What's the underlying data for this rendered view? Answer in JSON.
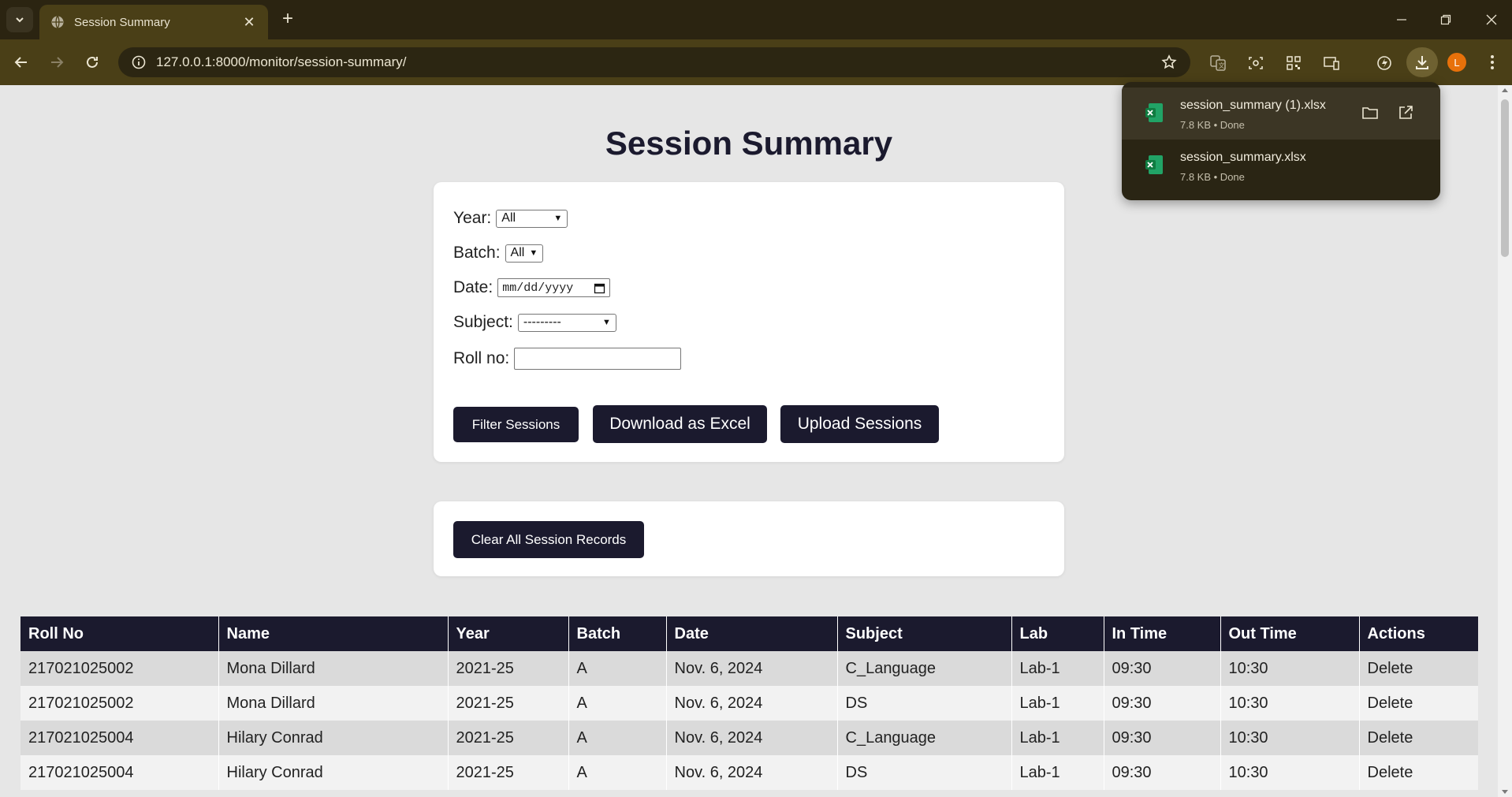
{
  "browser": {
    "tab_title": "Session Summary",
    "url": "127.0.0.1:8000/monitor/session-summary/",
    "profile_initial": "L"
  },
  "page": {
    "title": "Session Summary"
  },
  "filters": {
    "year_label": "Year:",
    "year_value": "All",
    "batch_label": "Batch:",
    "batch_value": "All",
    "date_label": "Date:",
    "date_placeholder": "mm/dd/yyyy",
    "subject_label": "Subject:",
    "subject_value": "---------",
    "roll_label": "Roll no:",
    "roll_value": ""
  },
  "buttons": {
    "filter": "Filter Sessions",
    "download": "Download as Excel",
    "upload": "Upload Sessions",
    "clear": "Clear All Session Records"
  },
  "table": {
    "headers": [
      "Roll No",
      "Name",
      "Year",
      "Batch",
      "Date",
      "Subject",
      "Lab",
      "In Time",
      "Out Time",
      "Actions"
    ],
    "rows": [
      [
        "217021025002",
        "Mona Dillard",
        "2021-25",
        "A",
        "Nov. 6, 2024",
        "C_Language",
        "Lab-1",
        "09:30",
        "10:30",
        "Delete"
      ],
      [
        "217021025002",
        "Mona Dillard",
        "2021-25",
        "A",
        "Nov. 6, 2024",
        "DS",
        "Lab-1",
        "09:30",
        "10:30",
        "Delete"
      ],
      [
        "217021025004",
        "Hilary Conrad",
        "2021-25",
        "A",
        "Nov. 6, 2024",
        "C_Language",
        "Lab-1",
        "09:30",
        "10:30",
        "Delete"
      ],
      [
        "217021025004",
        "Hilary Conrad",
        "2021-25",
        "A",
        "Nov. 6, 2024",
        "DS",
        "Lab-1",
        "09:30",
        "10:30",
        "Delete"
      ]
    ]
  },
  "downloads": {
    "items": [
      {
        "name": "session_summary (1).xlsx",
        "meta": "7.8 KB • Done"
      },
      {
        "name": "session_summary.xlsx",
        "meta": "7.8 KB • Done"
      }
    ]
  },
  "colors": {
    "accent": "#1b1a2e",
    "chrome_dark": "#2b2411",
    "chrome_toolbar": "#4a3f17",
    "page_bg": "#e6e6e6"
  }
}
